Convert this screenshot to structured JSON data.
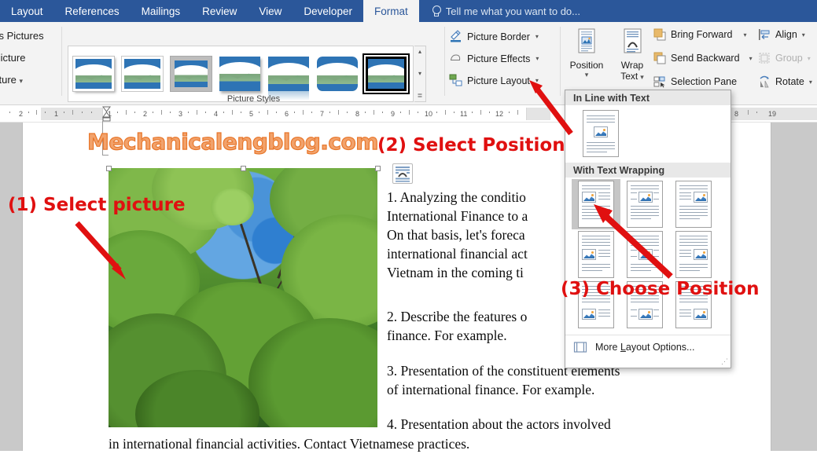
{
  "ribbon": {
    "tabs": [
      {
        "label": "Layout",
        "active": false
      },
      {
        "label": "References",
        "active": false
      },
      {
        "label": "Mailings",
        "active": false
      },
      {
        "label": "Review",
        "active": false
      },
      {
        "label": "View",
        "active": false
      },
      {
        "label": "Developer",
        "active": false
      },
      {
        "label": "Format",
        "active": true
      }
    ],
    "tell_me": "Tell me what you want to do...",
    "adjust_group": {
      "items": [
        "ss Pictures",
        "Picture",
        "cture"
      ],
      "full_items": [
        "Compress Pictures",
        "Change Picture",
        "Reset Picture"
      ],
      "caret": "▾"
    },
    "styles_group": {
      "label": "Picture Styles",
      "thumb_count": 7,
      "selected_index": 6,
      "scroll_up": "▴",
      "scroll_down": "▾",
      "scroll_more": "≣"
    },
    "picture_commands": [
      {
        "label": "Picture Border",
        "icon": "pencil-border-icon",
        "caret": "▾"
      },
      {
        "label": "Picture Effects",
        "icon": "effects-icon",
        "caret": "▾"
      },
      {
        "label": "Picture Layout",
        "icon": "layout-icon",
        "caret": "▾"
      }
    ],
    "arrange_group": {
      "position": {
        "label": "Position",
        "caret": "▾",
        "icon": "position-icon"
      },
      "wrap_text": {
        "label_line1": "Wrap",
        "label_line2": "Text",
        "caret": "▾",
        "icon": "wrap-text-icon"
      },
      "bring_forward": {
        "label": "Bring Forward",
        "caret": "▾",
        "icon": "bring-forward-icon"
      },
      "send_backward": {
        "label": "Send Backward",
        "caret": "▾",
        "icon": "send-backward-icon"
      },
      "selection_pane": {
        "label": "Selection Pane",
        "icon": "selection-pane-icon"
      },
      "align": {
        "label": "Align",
        "caret": "▾",
        "icon": "align-icon"
      },
      "group": {
        "label": "Group",
        "caret": "▾",
        "icon": "group-icon",
        "disabled": true
      },
      "rotate": {
        "label": "Rotate",
        "caret": "▾",
        "icon": "rotate-icon"
      }
    }
  },
  "ruler": {
    "left_numbers": [
      "2",
      "1"
    ],
    "right_numbers": [
      "1",
      "2",
      "3",
      "4",
      "5",
      "6",
      "7",
      "8",
      "9",
      "10",
      "11",
      "12"
    ],
    "far_right_numbers": [
      "8",
      "19"
    ]
  },
  "document": {
    "title": "Mechanicalengblog.com",
    "paragraphs": [
      {
        "lines": [
          "1. Analyzing the conditio",
          "International Finance to a",
          "On that basis, let's foreca",
          "international financial act",
          "Vietnam in the coming ti"
        ]
      },
      {
        "lines": [
          "2. Describe the features o",
          "finance. For example."
        ]
      },
      {
        "lines": [
          "3. Presentation of the constituent elements",
          "of international finance. For example."
        ]
      },
      {
        "lines": [
          "4. Presentation about the actors involved"
        ]
      }
    ],
    "bottom_line": "in international financial activities. Contact Vietnamese practices.",
    "layout_options_icon": "layout-options-icon",
    "image_alt": "tree-canopy-photo"
  },
  "position_menu": {
    "section_inline": "In Line with Text",
    "section_wrapping": "With Text Wrapping",
    "inline_option_count": 1,
    "wrapping_option_count": 9,
    "selected_wrapping_index": 0,
    "more_layout_options": "More Layout Options...",
    "more_layout_accesskey": "L",
    "resize_grip": "⋰"
  },
  "annotations": [
    {
      "id": "step1",
      "text": "(1) Select picture",
      "color": "#e01010"
    },
    {
      "id": "step2",
      "text": "(2) Select Position",
      "color": "#e01010"
    },
    {
      "id": "step3",
      "text": "(3) Choose Position",
      "color": "#e01010"
    }
  ],
  "colors": {
    "ribbon_blue": "#2b579a",
    "ribbon_bg": "#f3f3f3",
    "annotation_red": "#e01010",
    "title_orange": "#e8762a",
    "selection_gray": "#c6c6c6"
  }
}
